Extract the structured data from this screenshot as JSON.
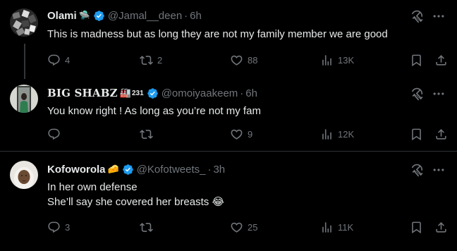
{
  "tweets": [
    {
      "name": "Olami",
      "name_emoji": "🛸",
      "handle": "@Jamal__deen",
      "dot": "·",
      "time": "6h",
      "text_lines": [
        "This is madness but as long they are not my family member we are good"
      ],
      "replies": "4",
      "reposts": "2",
      "likes": "88",
      "views": "13K"
    },
    {
      "name": "BIG SHABZ",
      "name_emoji": "🏭",
      "name_sup": "231",
      "handle": "@omoiyaakeem",
      "dot": "·",
      "time": "6h",
      "text_lines": [
        "You know right ! As long as you’re not my fam"
      ],
      "replies": "",
      "reposts": "",
      "likes": "9",
      "views": "12K"
    },
    {
      "name": "Kofoworola",
      "name_emoji": "🧀",
      "handle": "@Kofotweets_",
      "dot": "·",
      "time": "3h",
      "text_lines": [
        "In her own defense",
        "She’ll say she covered her breasts 😂"
      ],
      "replies": "3",
      "reposts": "",
      "likes": "25",
      "views": "11K"
    }
  ],
  "colors": {
    "background": "#000000",
    "text": "#e7e9ea",
    "muted": "#71767b",
    "verified": "#1d9bf0",
    "divider": "#2f3336"
  },
  "icons": [
    "verified-badge-icon",
    "grok-icon",
    "more-icon",
    "reply-icon",
    "repost-icon",
    "like-icon",
    "views-icon",
    "bookmark-icon",
    "share-icon"
  ]
}
